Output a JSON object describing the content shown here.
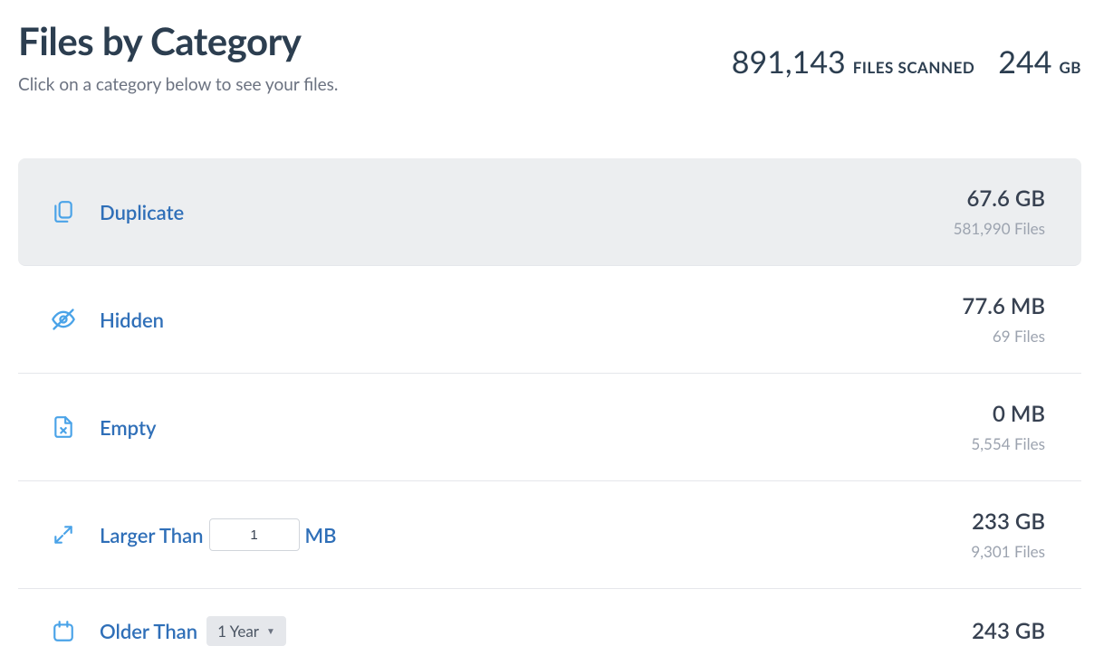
{
  "header": {
    "title": "Files by Category",
    "subtitle": "Click on a category below to see your files.",
    "files_scanned_count": "891,143",
    "files_scanned_label": "FILES SCANNED",
    "size_count": "244",
    "size_label": "GB"
  },
  "categories": [
    {
      "name": "Duplicate",
      "size": "67.6 GB",
      "files": "581,990 Files",
      "highlighted": true
    },
    {
      "name": "Hidden",
      "size": "77.6 MB",
      "files": "69 Files",
      "highlighted": false
    },
    {
      "name": "Empty",
      "size": "0 MB",
      "files": "5,554 Files",
      "highlighted": false
    },
    {
      "name_prefix": "Larger Than",
      "input_value": "1",
      "unit": "MB",
      "size": "233 GB",
      "files": "9,301 Files",
      "highlighted": false
    },
    {
      "name_prefix": "Older Than",
      "dropdown_value": "1 Year",
      "size": "243 GB",
      "files": "",
      "highlighted": false
    }
  ]
}
